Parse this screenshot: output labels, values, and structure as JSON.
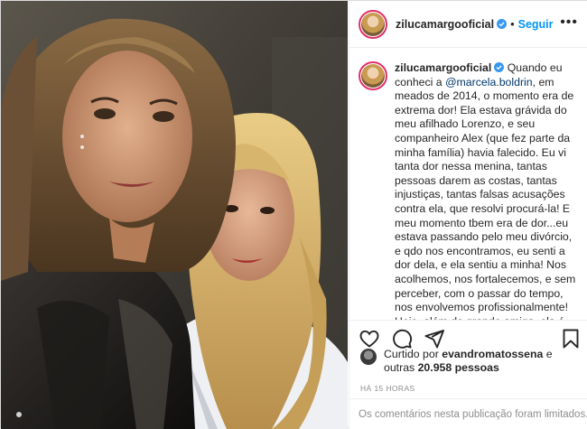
{
  "post": {
    "username": "zilucamargooficial",
    "follow_label": "Seguir",
    "dot": "•",
    "more_label": "•••",
    "caption_username": "zilucamargooficial",
    "caption": {
      "part1": " Quando eu conheci a ",
      "mention": "@marcela.boldrin",
      "part2": ", em meados de 2014, o momento era de extrema dor! Ela estava grávida do meu afilhado Lorenzo, e seu companheiro Alex (que fez parte da minha família) havia falecido. Eu vi tanta dor nessa menina, tantas pessoas darem as costas, tantas injustiças, tantas falsas acusações contra ela, que resolvi procurá-la! E meu momento tbem era de dor...eu estava passando pelo meu divórcio, e qdo nos encontramos, eu senti a dor dela, e ela sentiu a minha! Nos acolhemos, nos fortalecemos, e sem perceber, com o passar do tempo, nos envolvemos profissionalmente! Hoje, além de grande amiga, ela é meu guia"
    },
    "likes": {
      "prefix": "Curtido por ",
      "user": "evandromatossena",
      "middle": " e",
      "line2_prefix": "outras ",
      "count": "20.958 pessoas"
    },
    "timestamp": "HÁ 15 HORAS",
    "comments_notice": "Os comentários nesta publicação foram limitados.",
    "colors": {
      "accent_blue": "#0095f6",
      "verified_blue": "#3897f0",
      "mention": "#00376b",
      "muted": "#8e8e8e",
      "border": "#efefef"
    },
    "icons": [
      "verified-badge-icon",
      "more-options-icon",
      "like-heart-icon",
      "comment-icon",
      "share-icon",
      "save-bookmark-icon"
    ]
  }
}
